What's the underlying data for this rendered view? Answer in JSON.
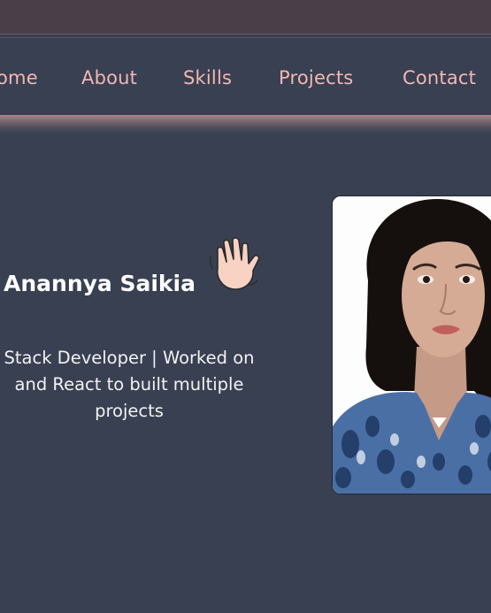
{
  "nav": {
    "items": [
      {
        "label": "ome"
      },
      {
        "label": "About"
      },
      {
        "label": "Skills"
      },
      {
        "label": "Projects"
      },
      {
        "label": "Contact"
      }
    ]
  },
  "hero": {
    "name": "Anannya Saikia",
    "wave_icon": "waving-hand-icon",
    "bio": "Stack Developer | Worked on\n and React to built multiple\nprojects",
    "photo": "profile-photo"
  },
  "colors": {
    "background": "#384052",
    "nav_text": "#f4b6b0",
    "accent_glow": "#a88488",
    "text": "#ffffff"
  }
}
